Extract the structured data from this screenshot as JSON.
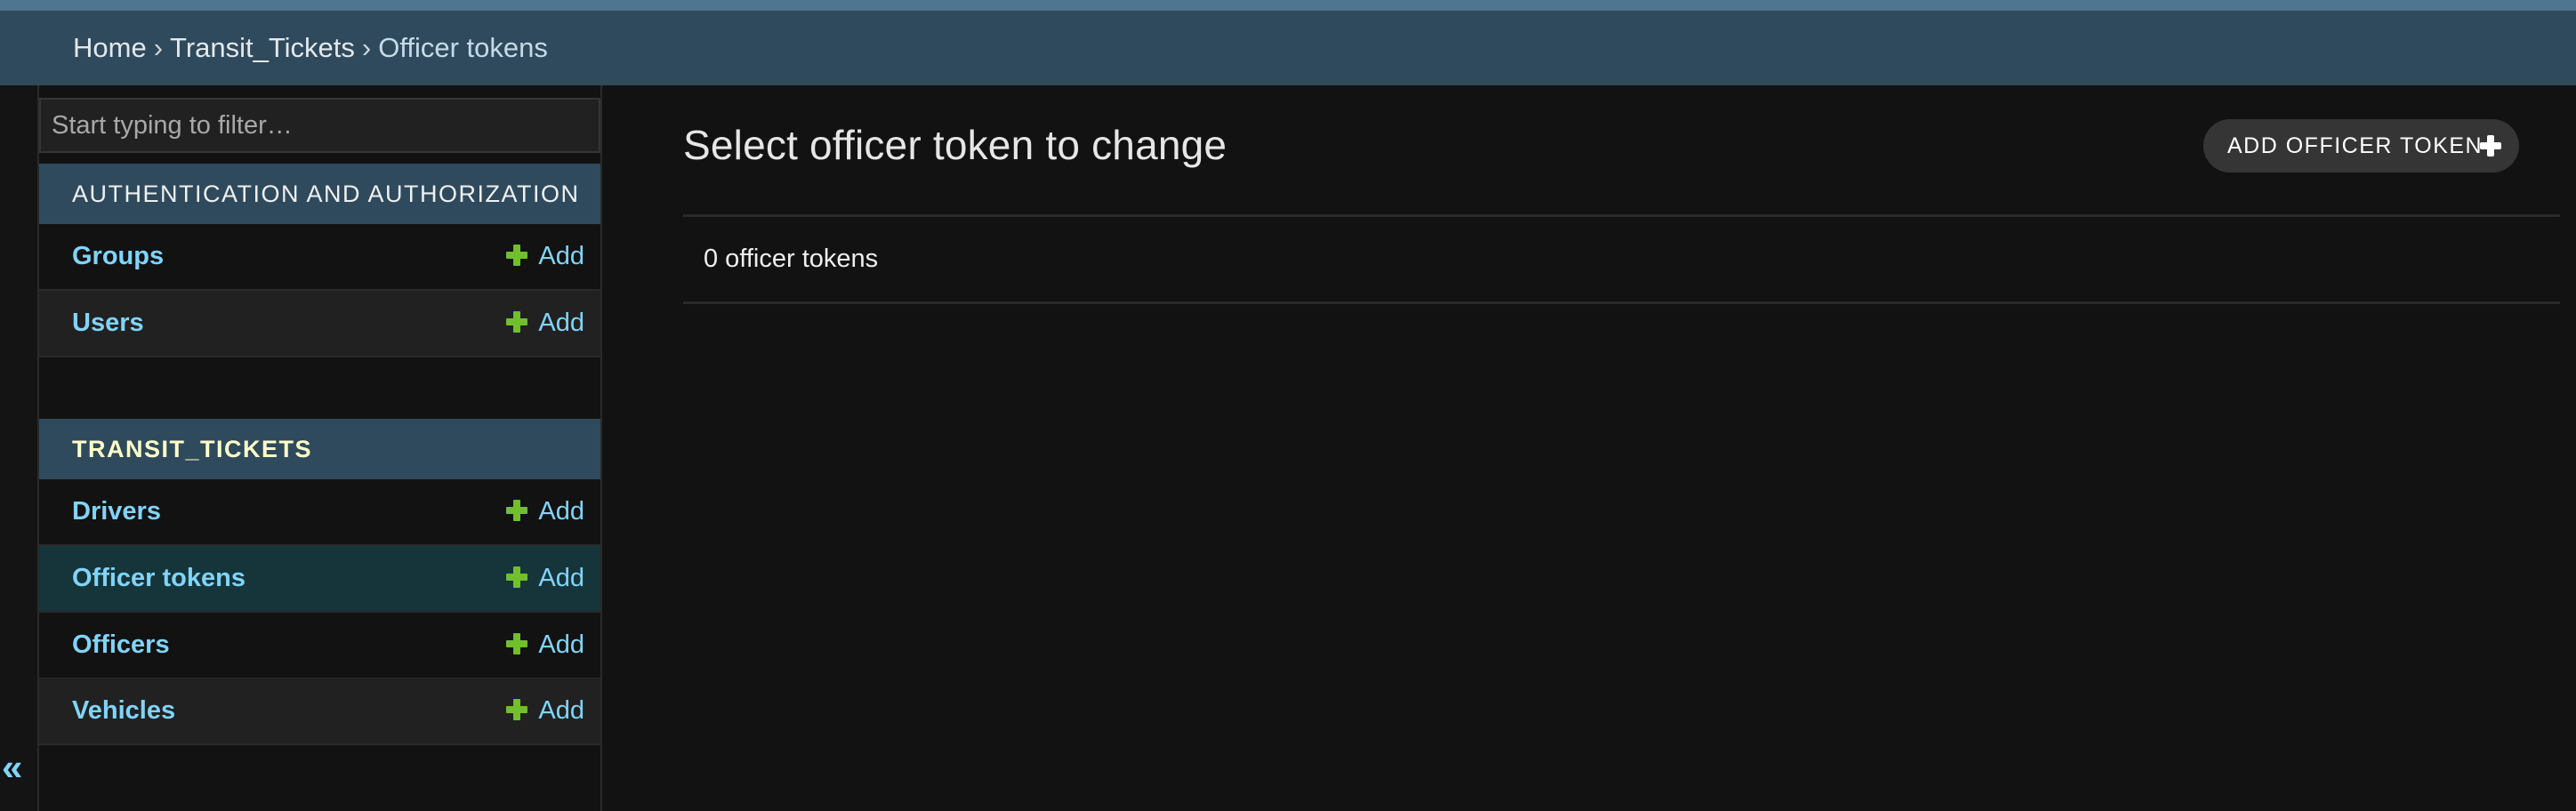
{
  "header": {
    "breadcrumbs": [
      {
        "label": "Home"
      },
      {
        "label": "Transit_Tickets"
      },
      {
        "label": "Officer tokens"
      }
    ],
    "separator": "›"
  },
  "sidebar": {
    "filter": {
      "placeholder": "Start typing to filter…",
      "value": ""
    },
    "collapse_icon": "«",
    "modules": [
      {
        "title": "AUTHENTICATION AND AUTHORIZATION",
        "models": [
          {
            "label": "Groups",
            "add_label": "Add",
            "selected": false
          },
          {
            "label": "Users",
            "add_label": "Add",
            "selected": false
          }
        ]
      },
      {
        "title": "TRANSIT_TICKETS",
        "models": [
          {
            "label": "Drivers",
            "add_label": "Add",
            "selected": false
          },
          {
            "label": "Officer tokens",
            "add_label": "Add",
            "selected": true
          },
          {
            "label": "Officers",
            "add_label": "Add",
            "selected": false
          },
          {
            "label": "Vehicles",
            "add_label": "Add",
            "selected": false
          }
        ]
      }
    ]
  },
  "main": {
    "title": "Select officer token to change",
    "add_button_label": "ADD OFFICER TOKEN",
    "result_count": "0 officer tokens"
  },
  "colors": {
    "header_bg": "#2f4a5c",
    "top_strip": "#4f7590",
    "link": "#81d4fa",
    "add_icon": "#70bf2b",
    "module_highlight": "#ffffc8",
    "selected_row": "#16353b",
    "page_bg": "#121212"
  }
}
